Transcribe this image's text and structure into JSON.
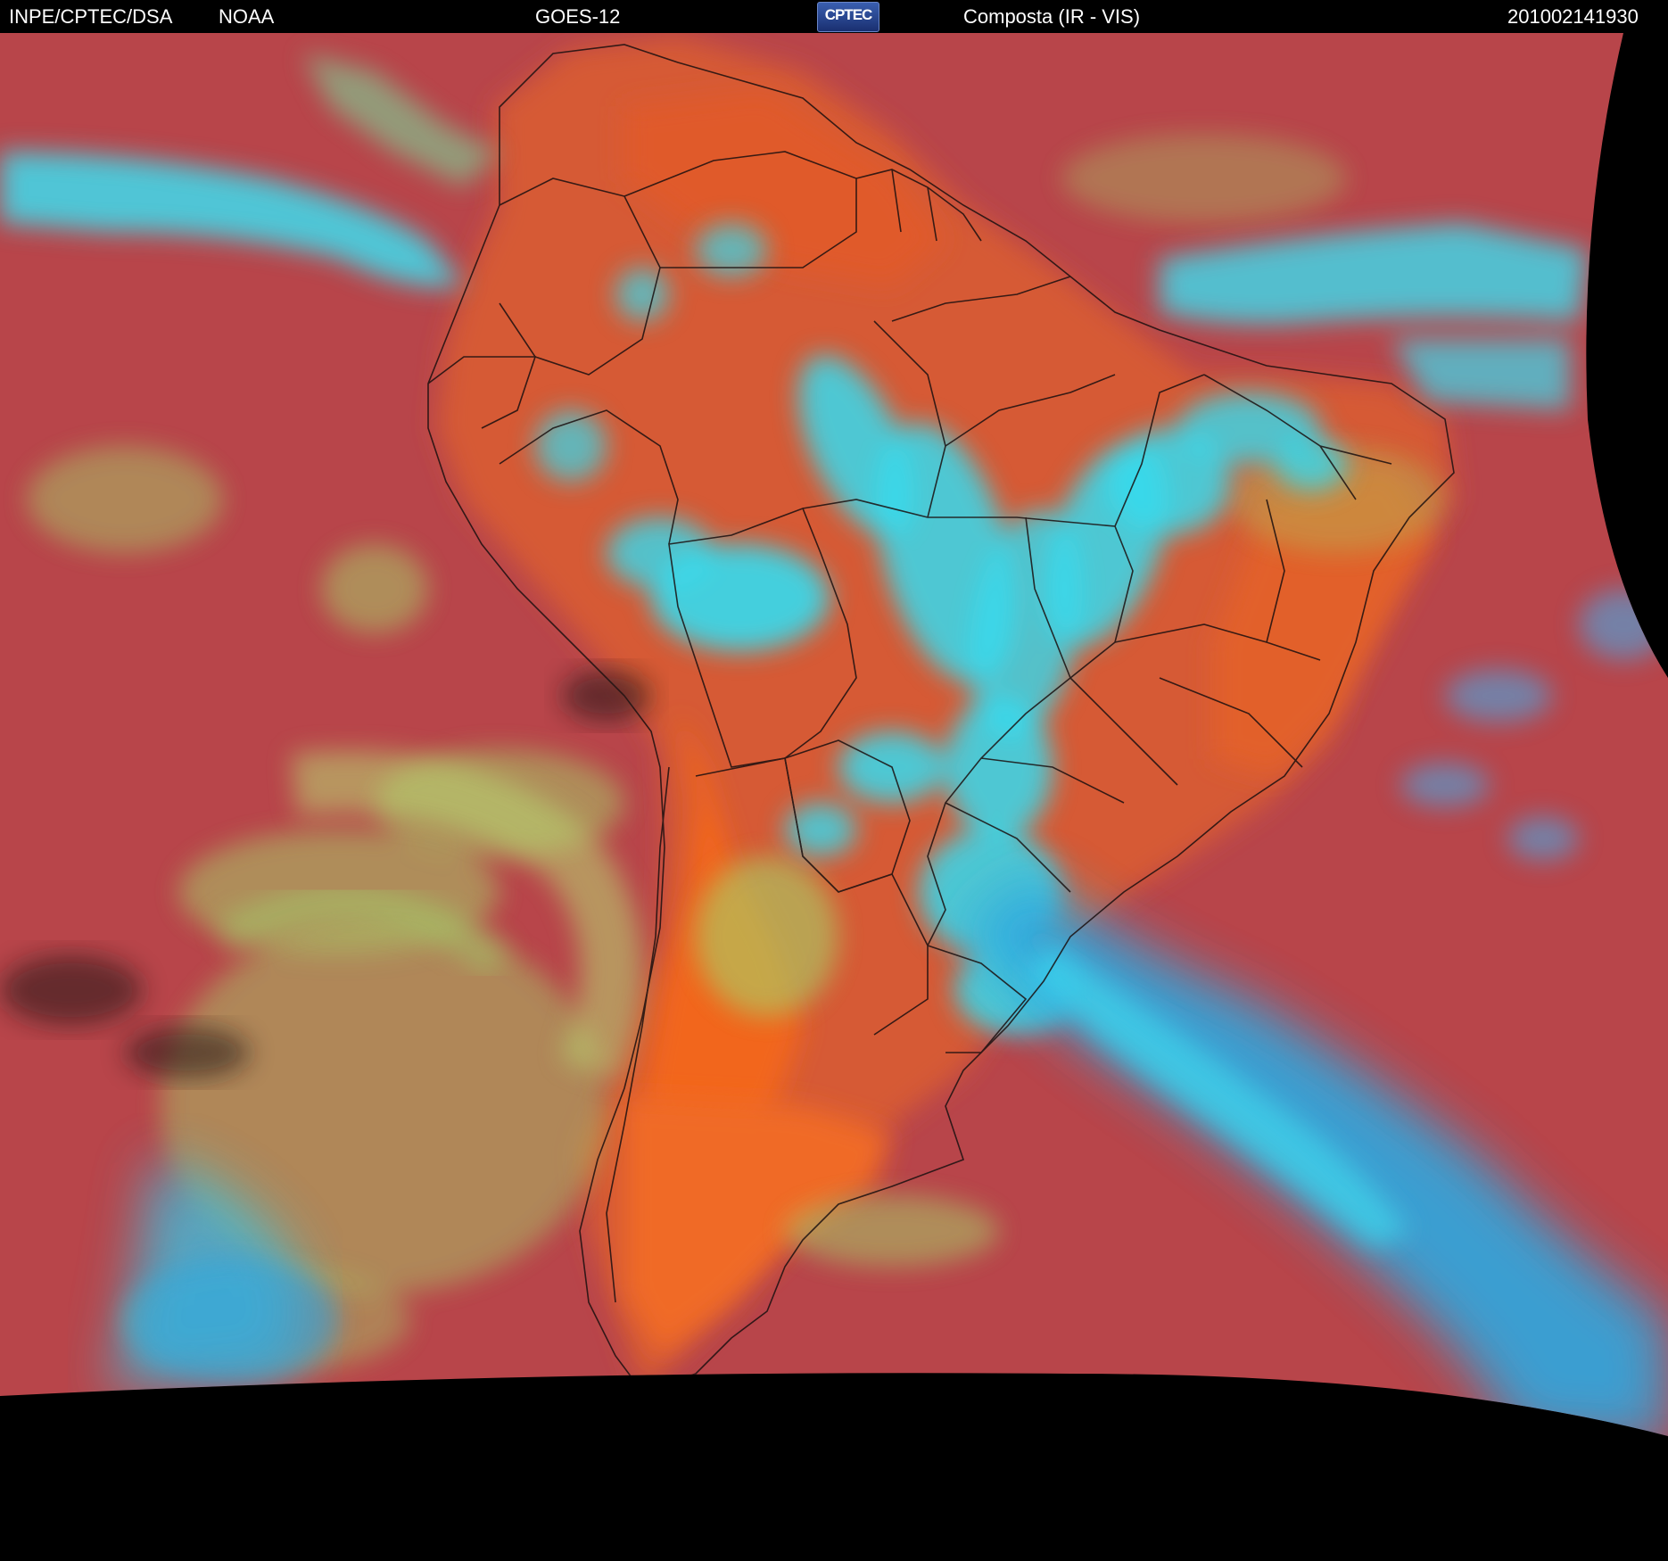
{
  "header": {
    "org": "INPE/CPTEC/DSA",
    "agency": "NOAA",
    "satellite": "GOES-12",
    "logo": "CPTEC",
    "product": "Composta (IR - VIS)",
    "timestamp": "201002141930"
  },
  "colors": {
    "background": "#000000",
    "clear_sky": "#b8454a",
    "land_warm": "#e0582a",
    "low_clouds": "#9fd86a",
    "high_clouds": "#34d9ec",
    "cirrus": "#3fa6e6",
    "borders": "#111111"
  },
  "icons": [
    "cptec-logo"
  ]
}
